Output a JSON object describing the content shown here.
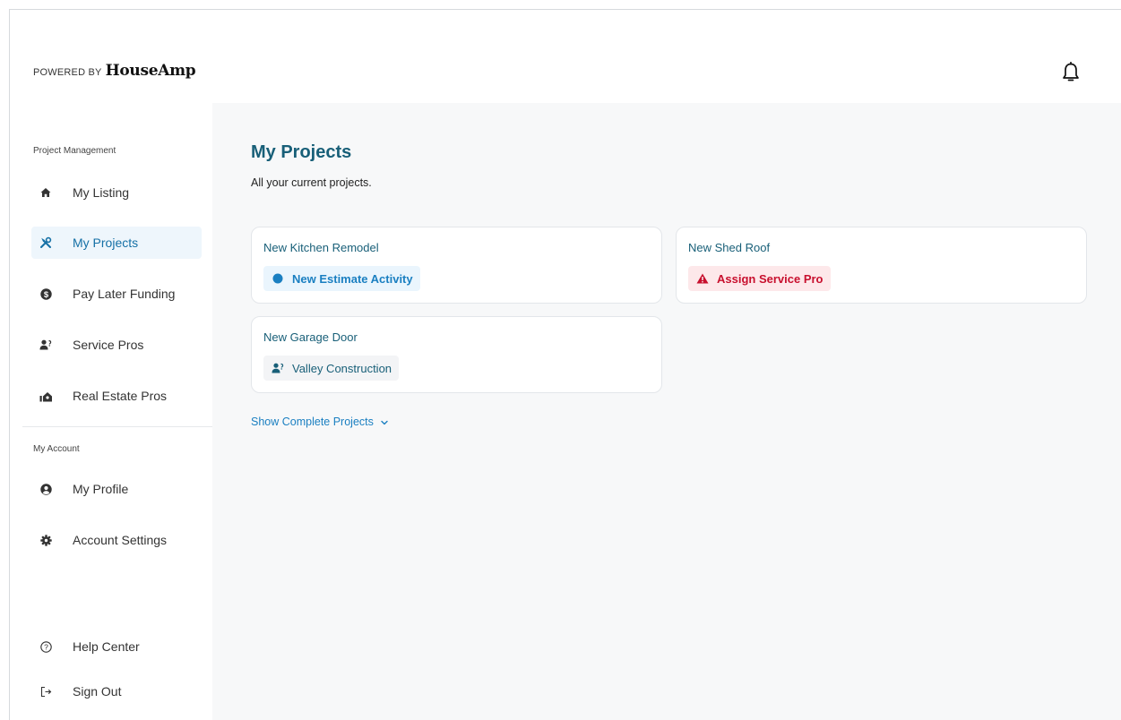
{
  "brand": {
    "powered_by": "POWERED BY",
    "name": "HouseAmp"
  },
  "header": {
    "notifications_icon": "bell-icon"
  },
  "sidebar": {
    "sections": [
      {
        "label": "Project Management"
      },
      {
        "label": "My Account"
      }
    ],
    "items": [
      {
        "label": "My Listing",
        "icon": "home-icon"
      },
      {
        "label": "My Projects",
        "icon": "tools-icon",
        "active": true
      },
      {
        "label": "Pay Later Funding",
        "icon": "dollar-circle-icon"
      },
      {
        "label": "Service Pros",
        "icon": "worker-icon"
      },
      {
        "label": "Real Estate Pros",
        "icon": "realtor-icon"
      },
      {
        "label": "My Profile",
        "icon": "user-circle-icon"
      },
      {
        "label": "Account Settings",
        "icon": "gear-icon"
      },
      {
        "label": "Help Center",
        "icon": "help-circle-icon"
      },
      {
        "label": "Sign Out",
        "icon": "sign-out-icon"
      }
    ]
  },
  "main": {
    "title": "My Projects",
    "subtitle": "All your current projects.",
    "projects": [
      {
        "title": "New Kitchen Remodel",
        "status": "New Estimate Activity",
        "status_type": "info",
        "status_icon": "dot-icon"
      },
      {
        "title": "New Shed Roof",
        "status": "Assign Service Pro",
        "status_type": "warning",
        "status_icon": "warning-icon"
      },
      {
        "title": "New Garage Door",
        "status": "Valley Construction",
        "status_type": "assigned",
        "status_icon": "worker-icon"
      }
    ],
    "show_complete_label": "Show Complete Projects"
  },
  "colors": {
    "accent": "#1a7fc1",
    "title": "#185f78",
    "warning": "#c8102e",
    "active_bg": "#eef6fc"
  }
}
